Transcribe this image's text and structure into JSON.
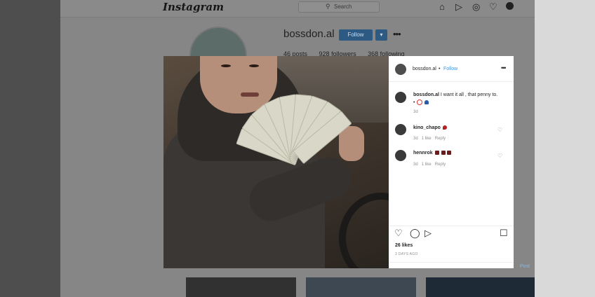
{
  "header": {
    "logo_text": "Instagram",
    "search_placeholder": "Search",
    "nav_icons": [
      "home-icon",
      "direct-icon",
      "explore-icon",
      "activity-heart-icon",
      "profile-avatar-icon"
    ]
  },
  "profile": {
    "username": "bossdon.al",
    "follow_label": "Follow",
    "dropdown_label": "▾",
    "more_label": "•••",
    "posts": "46 posts",
    "followers": "928 followers",
    "following": "368 following"
  },
  "post": {
    "username": "bossdon.al",
    "follow_label": "Follow",
    "more_label": "•••",
    "caption": {
      "username": "bossdon.al",
      "line1": "I want it all , that penny to.",
      "line2": "•",
      "time": "3d"
    },
    "comments": [
      {
        "username": "kino_chapo",
        "text": "",
        "time": "3d",
        "likes": "1 like",
        "reply": "Reply"
      },
      {
        "username": "hennrok",
        "text": "",
        "time": "3d",
        "likes": "1 like",
        "reply": "Reply"
      }
    ],
    "likes": "26 likes",
    "time": "3 DAYS AGO",
    "post_button": "Post"
  },
  "colors": {
    "accent": "#3897f0",
    "follow_button_dimmed": "#2d5a82",
    "overlay_bg": "#868686"
  }
}
